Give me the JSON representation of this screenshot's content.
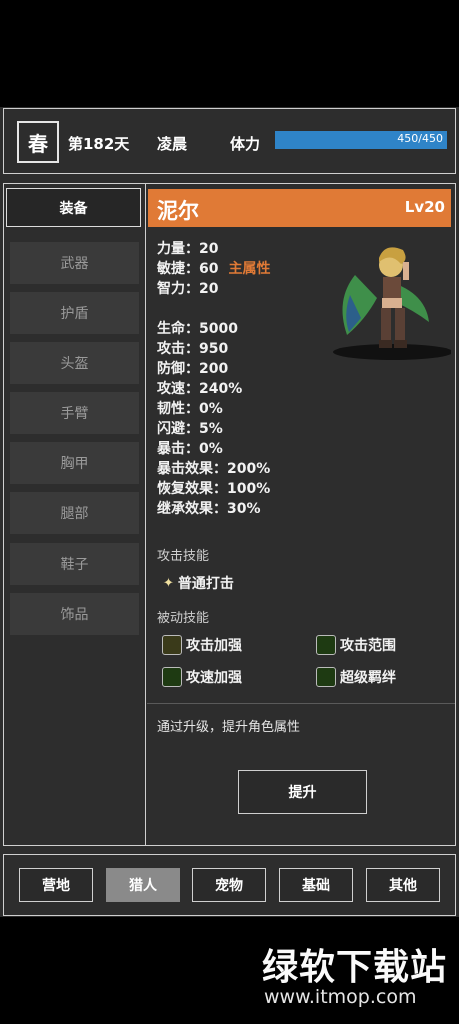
{
  "header": {
    "season": "春",
    "day": "第182天",
    "time": "凌晨",
    "stamina_label": "体力",
    "stamina_text": "450/450",
    "stamina_fraction": 1.0
  },
  "nav": {
    "title": "装备",
    "items": [
      "武器",
      "护盾",
      "头盔",
      "手臂",
      "胸甲",
      "腿部",
      "鞋子",
      "饰品"
    ]
  },
  "character": {
    "name": "泥尔",
    "level": "Lv20",
    "attrs": [
      {
        "text": "力量：20",
        "tag": ""
      },
      {
        "text": "敏捷：60",
        "tag": "主属性"
      },
      {
        "text": "智力：20",
        "tag": ""
      }
    ],
    "stats": [
      "生命：5000",
      "攻击：950",
      "防御：200",
      "攻速：240%",
      "韧性：0%",
      "闪避：5%",
      "暴击：0%",
      "暴击效果：200%",
      "恢复效果：100%",
      "继承效果：30%"
    ]
  },
  "skills": {
    "attack_title": "攻击技能",
    "attack_skill": "普通打击",
    "passive_title": "被动技能",
    "passives": [
      "攻击加强",
      "攻击范围",
      "攻速加强",
      "超级羁绊"
    ]
  },
  "upgrade": {
    "description": "通过升级，提升角色属性",
    "button": "提升"
  },
  "tabs": [
    "营地",
    "猎人",
    "宠物",
    "基础",
    "其他"
  ],
  "active_tab": "猎人",
  "watermark": {
    "title": "绿软下载站",
    "url": "www.itmop.com"
  },
  "colors": {
    "accent": "#e07a36",
    "stamina": "#2f84c8",
    "panel": "#2d2d2d"
  }
}
